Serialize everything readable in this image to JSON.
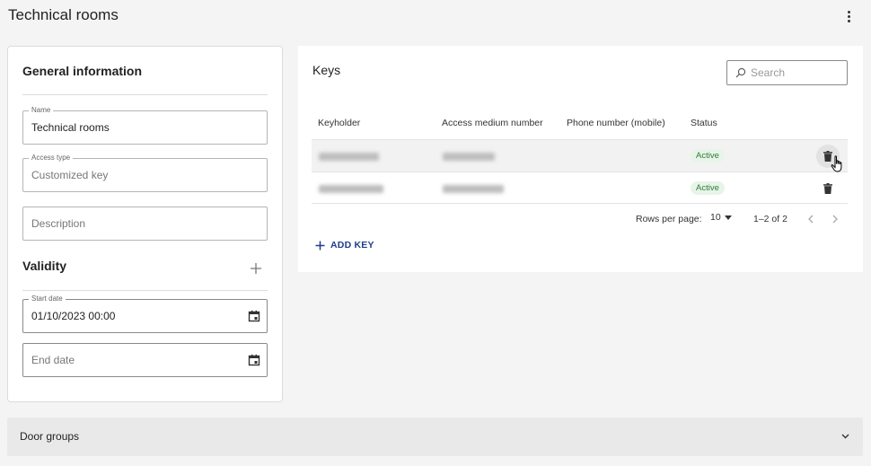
{
  "page": {
    "title": "Technical rooms",
    "more_icon": "more-vertical-icon"
  },
  "general": {
    "title": "General information",
    "name": {
      "label": "Name",
      "value": "Technical rooms"
    },
    "access_type": {
      "label": "Access type",
      "value": "Customized key"
    },
    "description": {
      "placeholder": "Description"
    },
    "validity_title": "Validity",
    "start_date": {
      "label": "Start date",
      "value": "01/10/2023 00:00"
    },
    "end_date": {
      "placeholder": "End date"
    }
  },
  "keys": {
    "title": "Keys",
    "search_placeholder": "Search",
    "columns": [
      "Keyholder",
      "Access medium number",
      "Phone number (mobile)",
      "Status"
    ],
    "rows": [
      {
        "status": "Active"
      },
      {
        "status": "Active"
      }
    ],
    "rows_per_page_label": "Rows per page:",
    "rows_per_page_value": "10",
    "range": "1–2 of 2",
    "add_key": "ADD KEY"
  },
  "door_groups": {
    "label": "Door groups"
  },
  "colors": {
    "accent": "#1f3f8c",
    "status_active": "#2e7d32",
    "status_active_bg": "#e8f4ea"
  }
}
